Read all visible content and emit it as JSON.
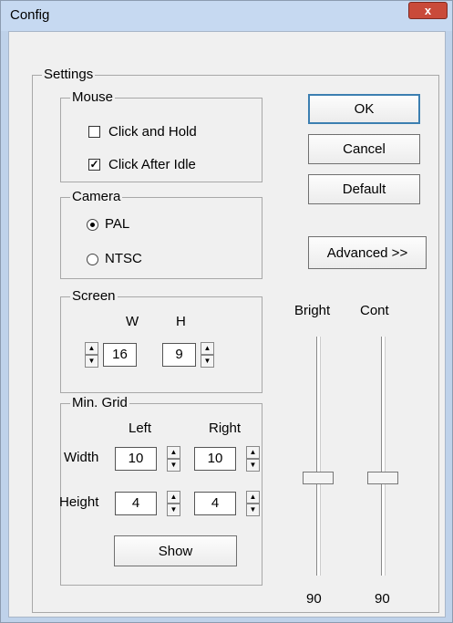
{
  "window": {
    "title": "Config",
    "close_glyph": "x"
  },
  "settings": {
    "label": "Settings",
    "mouse": {
      "label": "Mouse",
      "click_and_hold": {
        "label": "Click and Hold",
        "checked": false
      },
      "click_after_idle": {
        "label": "Click After Idle",
        "checked": true
      }
    },
    "camera": {
      "label": "Camera",
      "options": [
        "PAL",
        "NTSC"
      ],
      "selected": "PAL"
    },
    "screen": {
      "label": "Screen",
      "w_label": "W",
      "h_label": "H",
      "w_value": "16",
      "h_value": "9"
    },
    "min_grid": {
      "label": "Min. Grid",
      "left_label": "Left",
      "right_label": "Right",
      "width_label": "Width",
      "height_label": "Height",
      "width_left": "10",
      "width_right": "10",
      "height_left": "4",
      "height_right": "4",
      "show_button": "Show"
    },
    "buttons": {
      "ok": "OK",
      "cancel": "Cancel",
      "default": "Default",
      "advanced": "Advanced >>"
    },
    "sliders": {
      "bright": {
        "label": "Bright",
        "value": "90",
        "fraction": 0.57
      },
      "cont": {
        "label": "Cont",
        "value": "90",
        "fraction": 0.57
      }
    }
  }
}
